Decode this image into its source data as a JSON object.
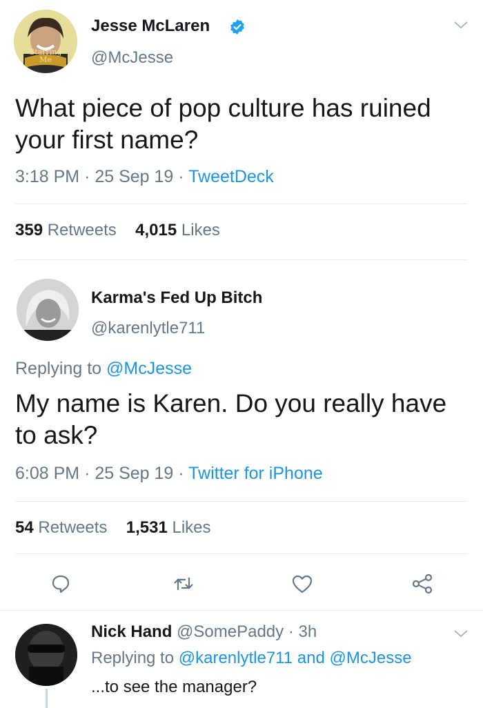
{
  "tweet1": {
    "display_name": "Jesse McLaren",
    "handle": "@McJesse",
    "avatar_badge_text": "Starring Me",
    "text_line1": "What piece of pop culture has ruined",
    "text_line2": "your first name?",
    "time": "3:18 PM",
    "date": "25 Sep 19",
    "source": "TweetDeck",
    "sep": "·",
    "retweets_count": "359",
    "retweets_label": "Retweets",
    "likes_count": "4,015",
    "likes_label": "Likes"
  },
  "tweet2": {
    "display_name": "Karma's Fed Up Bitch",
    "handle": "@karenlytle711",
    "replying_prefix": "Replying to",
    "replying_to": "@McJesse",
    "text_line1": "My name is Karen. Do you really have",
    "text_line2": "to ask?",
    "time": "6:08 PM",
    "date": "25 Sep 19",
    "source": "Twitter for iPhone",
    "sep": "·",
    "retweets_count": "54",
    "retweets_label": "Retweets",
    "likes_count": "1,531",
    "likes_label": "Likes"
  },
  "actions": [
    "reply-icon",
    "retweet-icon",
    "like-icon",
    "share-icon"
  ],
  "reply": {
    "display_name": "Nick Hand",
    "handle": "@SomePaddy",
    "sep": "·",
    "age": "3h",
    "replying_prefix": "Replying to",
    "replying_to_1": "@karenlytle711",
    "and": "and",
    "replying_to_2": "@McJesse",
    "text": "...to see the manager?"
  },
  "colors": {
    "link": "#1b95e0",
    "muted": "#657786",
    "text": "#14171a",
    "divider": "#e6ecf0",
    "verified": "#1da1f2"
  }
}
